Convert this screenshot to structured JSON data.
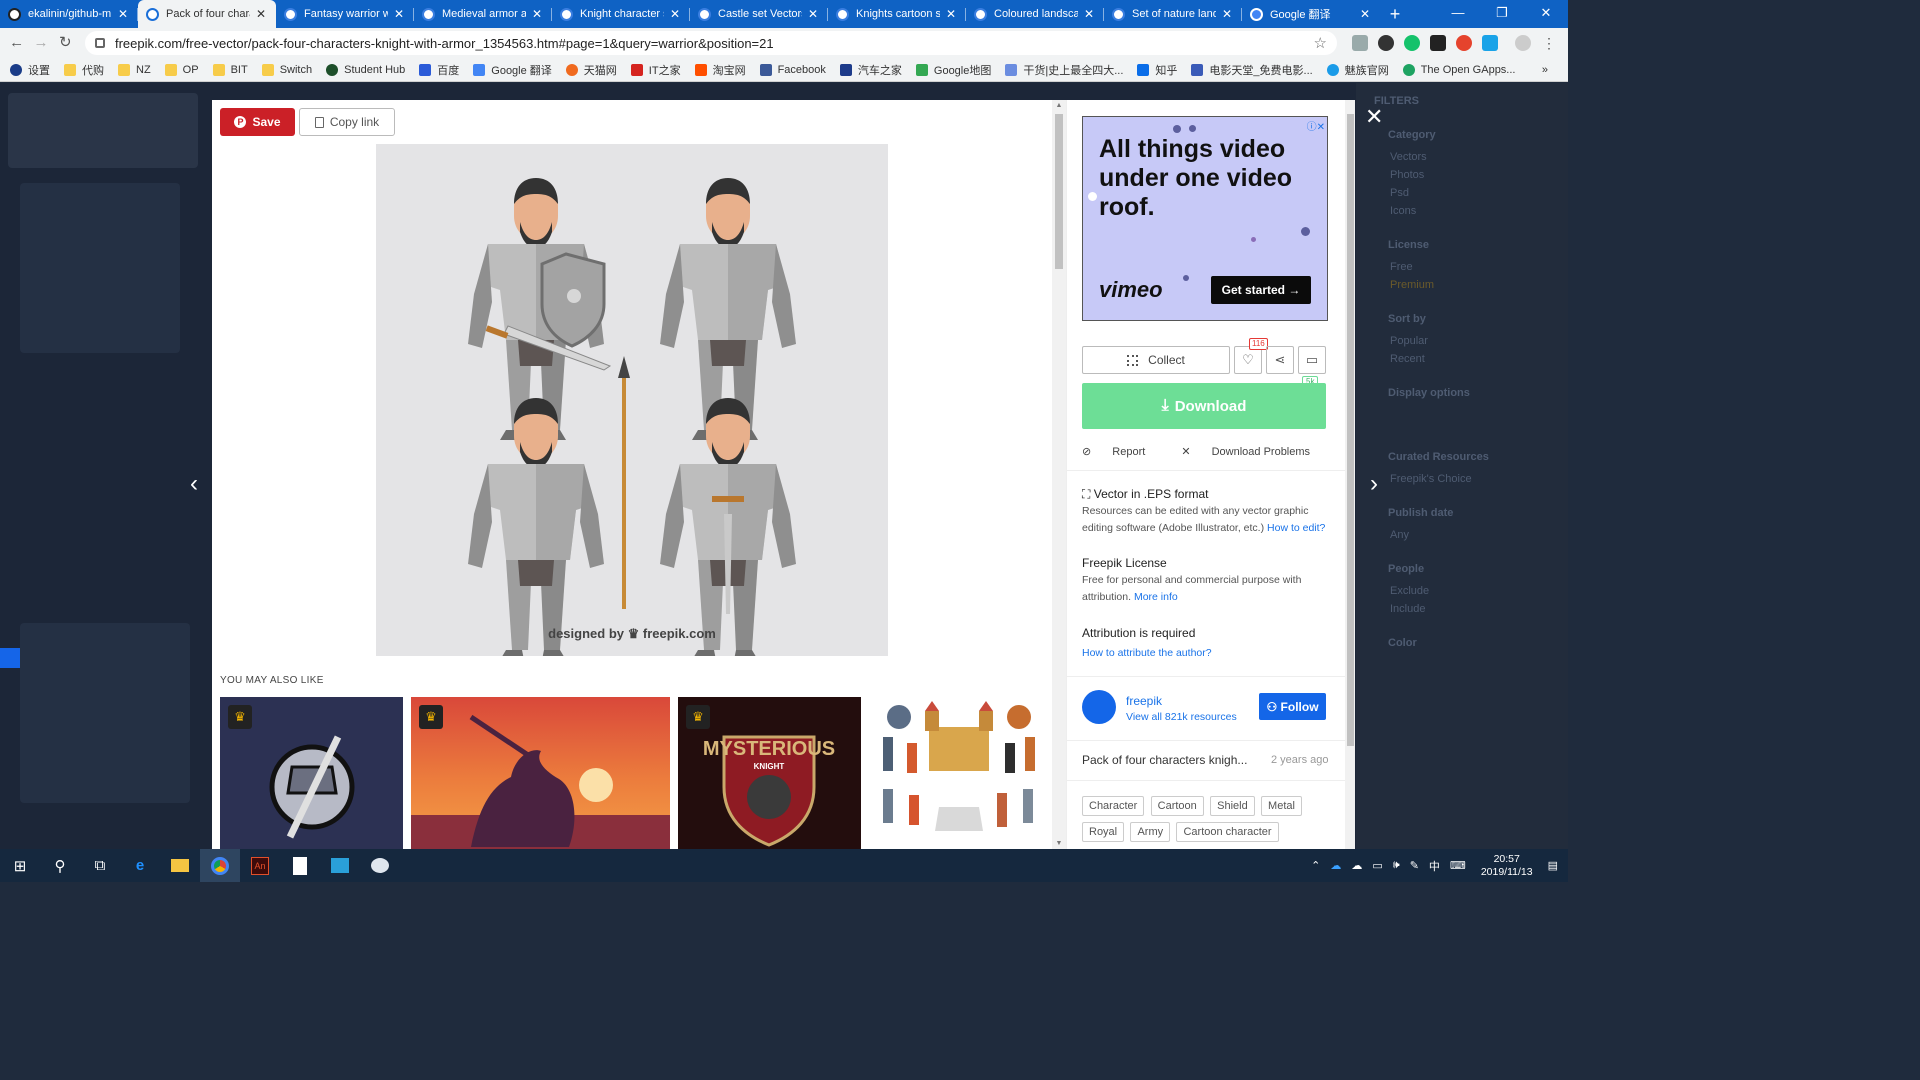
{
  "browser": {
    "tabs": [
      {
        "title": "ekalinin/github-m",
        "active": false,
        "icon": "github-icon"
      },
      {
        "title": "Pack of four chara",
        "active": true,
        "icon": "freepik-icon"
      },
      {
        "title": "Fantasy warrior wi",
        "active": false,
        "icon": "freepik-icon"
      },
      {
        "title": "Medieval armor an",
        "active": false,
        "icon": "freepik-icon"
      },
      {
        "title": "Knight character s",
        "active": false,
        "icon": "freepik-icon"
      },
      {
        "title": "Castle set Vectors",
        "active": false,
        "icon": "freepik-icon"
      },
      {
        "title": "Knights cartoon sc",
        "active": false,
        "icon": "freepik-icon"
      },
      {
        "title": "Coloured landscap",
        "active": false,
        "icon": "freepik-icon"
      },
      {
        "title": "Set of nature land",
        "active": false,
        "icon": "freepik-icon"
      },
      {
        "title": "Google 翻译",
        "active": false,
        "icon": "google-translate-icon"
      }
    ],
    "new_tab": "+",
    "url": "freepik.com/free-vector/pack-four-characters-knight-with-armor_1354563.htm#page=1&query=warrior&position=21",
    "bookmarks": [
      "设置",
      "代购",
      "NZ",
      "OP",
      "BIT",
      "Switch",
      "Student Hub",
      "百度",
      "Google 翻译",
      "天猫网",
      "IT之家",
      "淘宝网",
      "Facebook",
      "汽车之家",
      "Google地图",
      "干货|史上最全四大...",
      "知乎",
      "电影天堂_免费电影...",
      "魅族官网",
      "The Open GApps..."
    ],
    "bookmarks_more": "»"
  },
  "modal": {
    "save_label": "Save",
    "copy_link_label": "Copy link",
    "watermark": "designed by ♛ freepik.com",
    "also_like_heading": "YOU MAY ALSO LIKE",
    "related_4_labels": {
      "title": "MYSTERIOUS",
      "subtitle": "KNIGHT"
    }
  },
  "sidebar": {
    "ad": {
      "headline": "All things video under one video roof.",
      "brand": "vimeo",
      "cta": "Get started →",
      "adchoice": "ⓘ✕"
    },
    "collect_label": "Collect",
    "likes_count": "116",
    "downloads_count": "5k",
    "download_label": "Download",
    "report_label": "Report",
    "problems_label": "Download Problems",
    "format_title": "Vector in .EPS format",
    "format_text": "Resources can be edited with any vector graphic editing software (Adobe Illustrator, etc.)",
    "format_link": "How to edit?",
    "license_title": "Freepik License",
    "license_text": "Free for personal and commercial purpose with attribution.",
    "license_link": "More info",
    "attribution_title": "Attribution is required",
    "attribution_link": "How to attribute the author?",
    "author_name": "freepik",
    "author_sub": "View all 821k resources",
    "follow_label": "Follow",
    "resource_title": "Pack of four characters knigh...",
    "resource_age": "2 years ago",
    "tags": [
      "Character",
      "Cartoon",
      "Shield",
      "Metal",
      "Royal",
      "Army",
      "Cartoon character"
    ]
  },
  "filters": {
    "title": "FILTERS",
    "sections": [
      {
        "name": "Category",
        "items": [
          "Vectors",
          "Photos",
          "Psd",
          "Icons"
        ]
      },
      {
        "name": "License",
        "items": [
          "Free",
          "Premium"
        ]
      },
      {
        "name": "Sort by",
        "items": [
          "Popular",
          "Recent"
        ]
      },
      {
        "name": "Display options",
        "items": []
      },
      {
        "name": "Curated Resources",
        "items": [
          "Freepik's Choice"
        ]
      },
      {
        "name": "Publish date",
        "items": [
          "Any"
        ]
      },
      {
        "name": "People",
        "items": [
          "Exclude",
          "Include"
        ]
      },
      {
        "name": "Color",
        "items": []
      }
    ]
  },
  "taskbar": {
    "time": "20:57",
    "date": "2019/11/13",
    "ime": "中"
  },
  "colors": {
    "tab_strip": "#0f62c4",
    "save_red": "#cb2027",
    "download_green": "#6dde96",
    "follow_blue": "#1466e8",
    "ad_bg": "#c7c9f7"
  }
}
